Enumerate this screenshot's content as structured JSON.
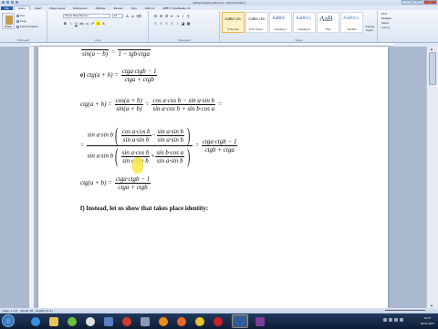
{
  "window": {
    "title": "Лабораторная работа 11 - Microsoft Word"
  },
  "tabs": [
    {
      "label": "File"
    },
    {
      "label": "Home"
    },
    {
      "label": "Insert"
    },
    {
      "label": "Page Layout"
    },
    {
      "label": "References"
    },
    {
      "label": "Mailings"
    },
    {
      "label": "Review"
    },
    {
      "label": "View"
    },
    {
      "label": "Add-Ins"
    },
    {
      "label": "ABBYY FineReader 11"
    }
  ],
  "clipboard": {
    "paste": "Paste",
    "cut": "Cut",
    "copy": "Copy",
    "format_painter": "Format Painter",
    "label": "Clipboard"
  },
  "font": {
    "name": "Times New Roman",
    "size": "12",
    "label": "Font"
  },
  "paragraph": {
    "label": "Paragraph"
  },
  "styles": {
    "label": "Styles",
    "items": [
      {
        "sample": "AaBbCcDc",
        "name": "¶ Normal"
      },
      {
        "sample": "AaBbCcDc",
        "name": "¶ No Spaci..."
      },
      {
        "sample": "AaBbC",
        "name": "Heading 1"
      },
      {
        "sample": "AaBbCc",
        "name": "Heading 2"
      },
      {
        "sample": "AaB",
        "name": "Title"
      },
      {
        "sample": "AaBbCc.",
        "name": "Subtitle"
      }
    ],
    "change_styles": "Change Styles"
  },
  "editing": {
    "find": "Find",
    "replace": "Replace",
    "select": "Select",
    "label": "Editing"
  },
  "document": {
    "top_fragment_left": "sin(a − b)",
    "top_fragment_right": "1 − tgb·ctga",
    "item_e_label": "e)",
    "item_e_lhs": "ctg(a + b) =",
    "item_e_num": "ctga·ctgb − 1",
    "item_e_den": "ctga + ctgb",
    "eq1_lhs": "ctg(a + b) =",
    "eq1_f1_num": "cos(a + b)",
    "eq1_f1_den": "sin(a + b)",
    "eq1_f2_num": "cos a·cos b − sin a·sin b",
    "eq1_f2_den": "sin a·cos b + sin b·cos a",
    "eq2_prefix": "sin a·sin b",
    "eq2_a_num": "cos a·cos b",
    "eq2_a_den": "sin a·sin b",
    "eq2_b_num": "sin a·sin b",
    "eq2_b_den": "sin a·sin b",
    "eq2_c_num": "sin a·cos b",
    "eq2_c_den": "sin a·sin b",
    "eq2_d_num": "sin b·cos a",
    "eq2_d_den": "sin a·sin b",
    "eq2_result_num": "ctga·ctgb − 1",
    "eq2_result_den": "ctgb + ctga",
    "eq3_lhs": "ctg(a + b) =",
    "eq3_num": "ctga·ctgb − 1",
    "eq3_den": "ctga + ctgb",
    "item_f": "f) Instead, let us show that takes place identity:"
  },
  "status": {
    "page": "Page: 1 of 6",
    "words": "Words: 98",
    "language": "English (U.S.)"
  },
  "taskbar": {
    "time": "12:37",
    "date": "08.01.2014"
  }
}
